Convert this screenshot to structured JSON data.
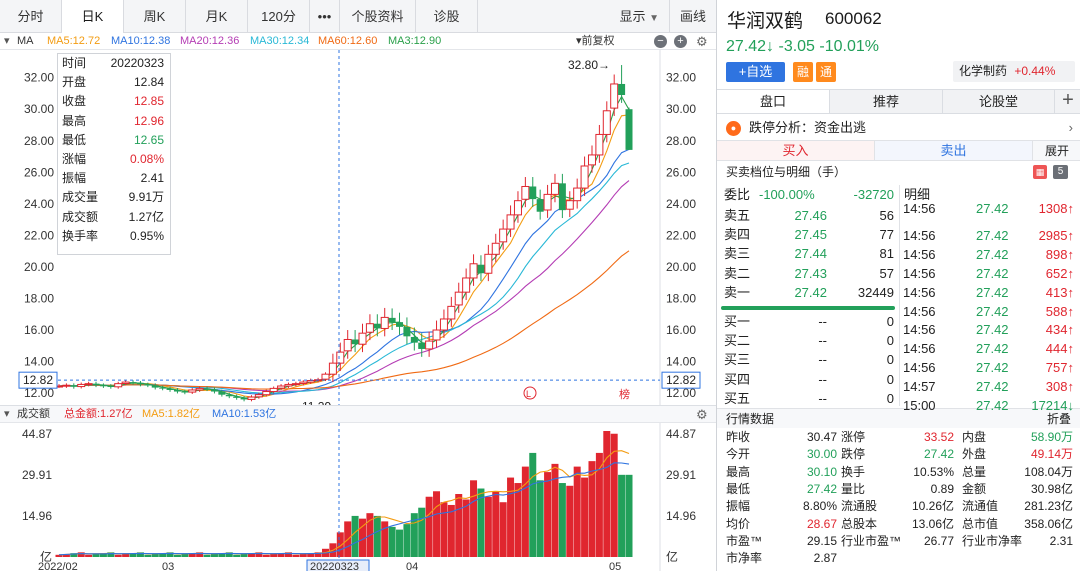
{
  "toolbar": {
    "tabs": [
      "分时",
      "日K",
      "周K",
      "月K",
      "120分",
      "•••",
      "个股资料",
      "诊股"
    ],
    "active_index": 1,
    "display_label": "显示",
    "draw_label": "画线"
  },
  "ma_bar": {
    "label": "MA",
    "items": [
      {
        "text": "MA5:12.72",
        "color": "#f39c12"
      },
      {
        "text": "MA10:12.38",
        "color": "#2f74e0"
      },
      {
        "text": "MA20:12.36",
        "color": "#b43cb4"
      },
      {
        "text": "MA30:12.34",
        "color": "#28b8d6"
      },
      {
        "text": "MA60:12.60",
        "color": "#f06a14"
      },
      {
        "text": "MA3:12.90",
        "color": "#2aa04a"
      }
    ],
    "adjust_label": "前复权"
  },
  "price_axis": [
    "32.00",
    "30.00",
    "28.00",
    "26.00",
    "24.00",
    "22.00",
    "20.00",
    "18.00",
    "16.00",
    "14.00",
    "12.00"
  ],
  "cursor_price": "12.82",
  "annotations": {
    "high": "32.80",
    "low": "11.29",
    "marker_l": "L",
    "marker_bang": "榜"
  },
  "info_box": {
    "rows": [
      {
        "label": "时间",
        "value": "20220323",
        "color": "#222222"
      },
      {
        "label": "开盘",
        "value": "12.84",
        "color": "#222222"
      },
      {
        "label": "收盘",
        "value": "12.85",
        "color": "#e0262f"
      },
      {
        "label": "最高",
        "value": "12.96",
        "color": "#e0262f"
      },
      {
        "label": "最低",
        "value": "12.65",
        "color": "#22a05a"
      },
      {
        "label": "涨幅",
        "value": "0.08%",
        "color": "#e0262f"
      },
      {
        "label": "振幅",
        "value": "2.41",
        "color": "#222222"
      },
      {
        "label": "成交量",
        "value": "9.91万",
        "color": "#222222"
      },
      {
        "label": "成交额",
        "value": "1.27亿",
        "color": "#222222"
      },
      {
        "label": "换手率",
        "value": "0.95%",
        "color": "#222222"
      }
    ]
  },
  "volume_bar": {
    "label": "成交额",
    "items": [
      {
        "text": "总金额:1.27亿",
        "color": "#e0262f"
      },
      {
        "text": "MA5:1.82亿",
        "color": "#f39c12"
      },
      {
        "text": "MA10:1.53亿",
        "color": "#2f74e0"
      }
    ]
  },
  "volume_axis": [
    "44.87",
    "29.91",
    "14.96",
    "亿"
  ],
  "date_axis": [
    "2022/02",
    "03",
    "20220323",
    "04",
    "05"
  ],
  "stock": {
    "name": "华润双鹤",
    "code": "600062",
    "price_line": "27.42↓ -3.05 -10.01%",
    "add_fav": "+自选",
    "badge_rong": "融",
    "badge_tong": "通",
    "industry": "化学制药",
    "industry_change": "+0.44%"
  },
  "right_tabs": [
    "盘口",
    "推荐",
    "论股堂",
    "+"
  ],
  "stop_analysis": {
    "icon": "●",
    "text": "跌停分析：资金出逃",
    "more": "展开"
  },
  "buy_label": "买入",
  "sell_label": "卖出",
  "expand_label": "展开",
  "orderbook_title": "买卖档位与明细（手）",
  "orderbook_badge": "5",
  "weibi": {
    "label": "委比",
    "pct": "-100.00%",
    "diff": "-32720"
  },
  "detail_title": "明细",
  "asks": [
    {
      "label": "卖五",
      "price": "27.46",
      "vol": "56"
    },
    {
      "label": "卖四",
      "price": "27.45",
      "vol": "77"
    },
    {
      "label": "卖三",
      "price": "27.44",
      "vol": "81"
    },
    {
      "label": "卖二",
      "price": "27.43",
      "vol": "57"
    },
    {
      "label": "卖一",
      "price": "27.42",
      "vol": "32449"
    }
  ],
  "bids": [
    {
      "label": "买一",
      "price": "--",
      "vol": "0"
    },
    {
      "label": "买二",
      "price": "--",
      "vol": "0"
    },
    {
      "label": "买三",
      "price": "--",
      "vol": "0"
    },
    {
      "label": "买四",
      "price": "--",
      "vol": "0"
    },
    {
      "label": "买五",
      "price": "--",
      "vol": "0"
    }
  ],
  "details": [
    {
      "time": "14:56",
      "price": "27.42",
      "vol": "1308↑"
    },
    {
      "time": "14:56",
      "price": "27.42",
      "vol": "2985↑"
    },
    {
      "time": "14:56",
      "price": "27.42",
      "vol": "898↑"
    },
    {
      "time": "14:56",
      "price": "27.42",
      "vol": "652↑"
    },
    {
      "time": "14:56",
      "price": "27.42",
      "vol": "413↑"
    },
    {
      "time": "14:56",
      "price": "27.42",
      "vol": "588↑"
    },
    {
      "time": "14:56",
      "price": "27.42",
      "vol": "434↑"
    },
    {
      "time": "14:56",
      "price": "27.42",
      "vol": "444↑"
    },
    {
      "time": "14:56",
      "price": "27.42",
      "vol": "757↑"
    },
    {
      "time": "14:57",
      "price": "27.42",
      "vol": "308↑"
    },
    {
      "time": "15:00",
      "price": "27.42",
      "vol": "17214↓"
    }
  ],
  "quote": {
    "title": "行情数据",
    "collapse": "折叠",
    "rows": [
      [
        {
          "l": "昨收",
          "v": "30.47",
          "c": "#222222"
        },
        {
          "l": "涨停",
          "v": "33.52",
          "c": "#e0262f"
        },
        {
          "l": "内盘",
          "v": "58.90万",
          "c": "#22a05a"
        }
      ],
      [
        {
          "l": "今开",
          "v": "30.00",
          "c": "#22a05a"
        },
        {
          "l": "跌停",
          "v": "27.42",
          "c": "#22a05a"
        },
        {
          "l": "外盘",
          "v": "49.14万",
          "c": "#e0262f"
        }
      ],
      [
        {
          "l": "最高",
          "v": "30.10",
          "c": "#22a05a"
        },
        {
          "l": "换手",
          "v": "10.53%",
          "c": "#222222"
        },
        {
          "l": "总量",
          "v": "108.04万",
          "c": "#222222"
        }
      ],
      [
        {
          "l": "最低",
          "v": "27.42",
          "c": "#22a05a"
        },
        {
          "l": "量比",
          "v": "0.89",
          "c": "#222222"
        },
        {
          "l": "金额",
          "v": "30.98亿",
          "c": "#222222"
        }
      ],
      [
        {
          "l": "振幅",
          "v": "8.80%",
          "c": "#222222"
        },
        {
          "l": "流通股",
          "v": "10.26亿",
          "c": "#222222"
        },
        {
          "l": "流通值",
          "v": "281.23亿",
          "c": "#222222"
        }
      ],
      [
        {
          "l": "均价",
          "v": "28.67",
          "c": "#e0262f"
        },
        {
          "l": "总股本",
          "v": "13.06亿",
          "c": "#222222"
        },
        {
          "l": "总市值",
          "v": "358.06亿",
          "c": "#222222"
        }
      ],
      [
        {
          "l": "市盈™",
          "v": "29.15",
          "c": "#222222"
        },
        {
          "l": "行业市盈™",
          "v": "26.77",
          "c": "#222222"
        },
        {
          "l": "行业市净率",
          "v": "2.31",
          "c": "#222222"
        }
      ],
      [
        {
          "l": "市净率",
          "v": "2.87",
          "c": "#222222"
        }
      ]
    ]
  },
  "colors": {
    "up": "#e0262f",
    "down": "#22a05a",
    "accent": "#2f74e0"
  }
}
